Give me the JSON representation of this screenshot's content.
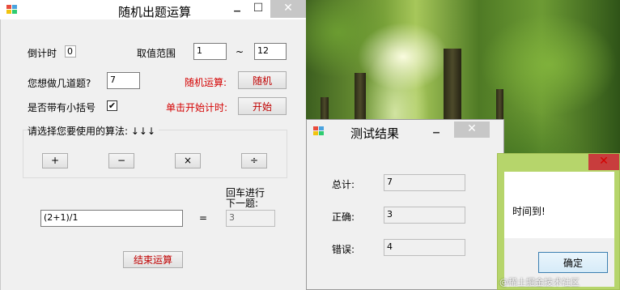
{
  "main_window": {
    "title": "随机出题运算",
    "min_glyph": "▁",
    "max_glyph": "☐",
    "close_glyph": "✕",
    "countdown_label": "倒计时",
    "countdown_value": "0",
    "range_label": "取值范围",
    "range_min": "1",
    "range_sep": "~",
    "range_max": "12",
    "count_label": "您想做几道题?",
    "count_value": "7",
    "random_label": "随机运算:",
    "random_button": "随机",
    "bracket_label": "是否带有小括号",
    "bracket_checked": "✔",
    "start_label": "单击开始计时:",
    "start_button": "开始",
    "ops_label": "请选择您要使用的算法: ↓↓↓",
    "ops": [
      "+",
      "−",
      "×",
      "÷"
    ],
    "expression": "(2+1)/1",
    "equals": "=",
    "enter_hint": "回车进行下一题:",
    "answer": "3",
    "end_button": "结束运算"
  },
  "result_window": {
    "title": "测试结果",
    "min_glyph": "▁",
    "close_glyph": "✕",
    "total_label": "总计:",
    "total_value": "7",
    "correct_label": "正确:",
    "correct_value": "3",
    "wrong_label": "错误:",
    "wrong_value": "4"
  },
  "message_box": {
    "close_glyph": "✕",
    "message": "时间到!",
    "ok_button": "确定",
    "accent": "#b6d56b"
  },
  "watermark": "@稀土掘金技术社区"
}
